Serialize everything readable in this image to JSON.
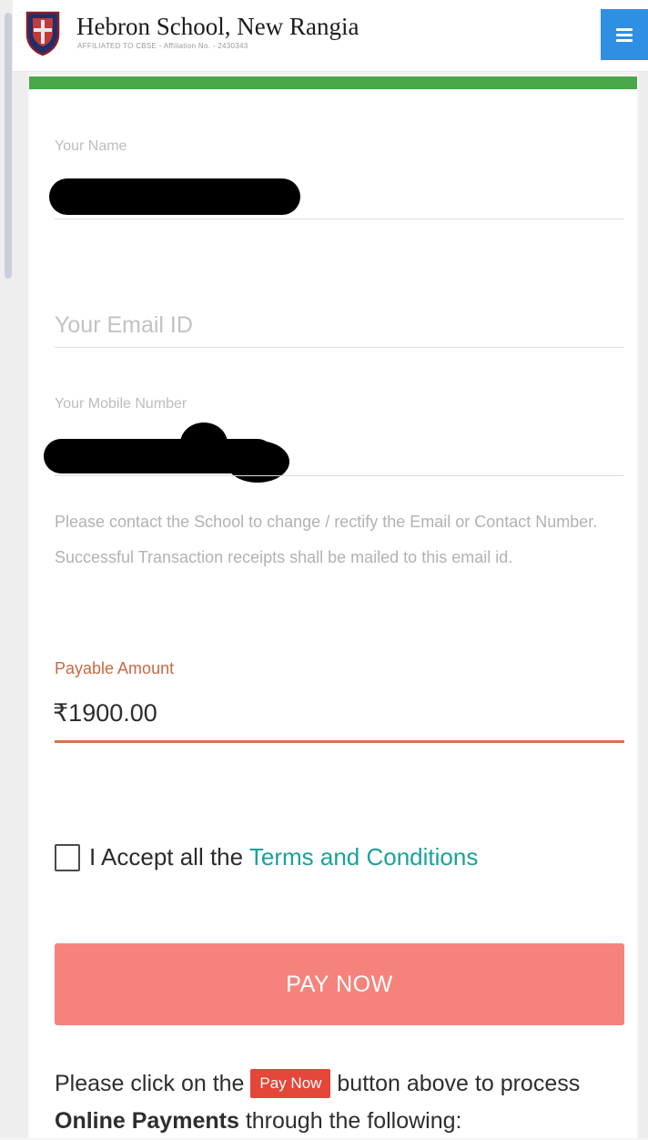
{
  "header": {
    "school_name": "Hebron School, New Rangia",
    "affiliation": "AFFILIATED TO CBSE - Affiliation No. - 2430343"
  },
  "form": {
    "name_label": "Your Name",
    "email_placeholder": "Your Email ID",
    "mobile_label": "Your Mobile Number",
    "helper_text": "Please contact the School to change / rectify the Email or Contact Number. Successful Transaction receipts shall be mailed to this email id.",
    "amount_label": "Payable Amount",
    "amount_value": "₹1900.00",
    "terms_prefix": "I Accept all the",
    "terms_link": "Terms and Conditions",
    "pay_button": "PAY NOW"
  },
  "info": {
    "prefix": "Please click on the",
    "badge": "Pay Now",
    "middle": "button above to process",
    "bold": "Online Payments",
    "suffix": "through the following:"
  },
  "colors": {
    "accent_green": "#49a84a",
    "menu_blue": "#2f8fe3",
    "pay_button": "#f5837c",
    "link_teal": "#1aa19a",
    "amount_orange": "#d7734a"
  }
}
